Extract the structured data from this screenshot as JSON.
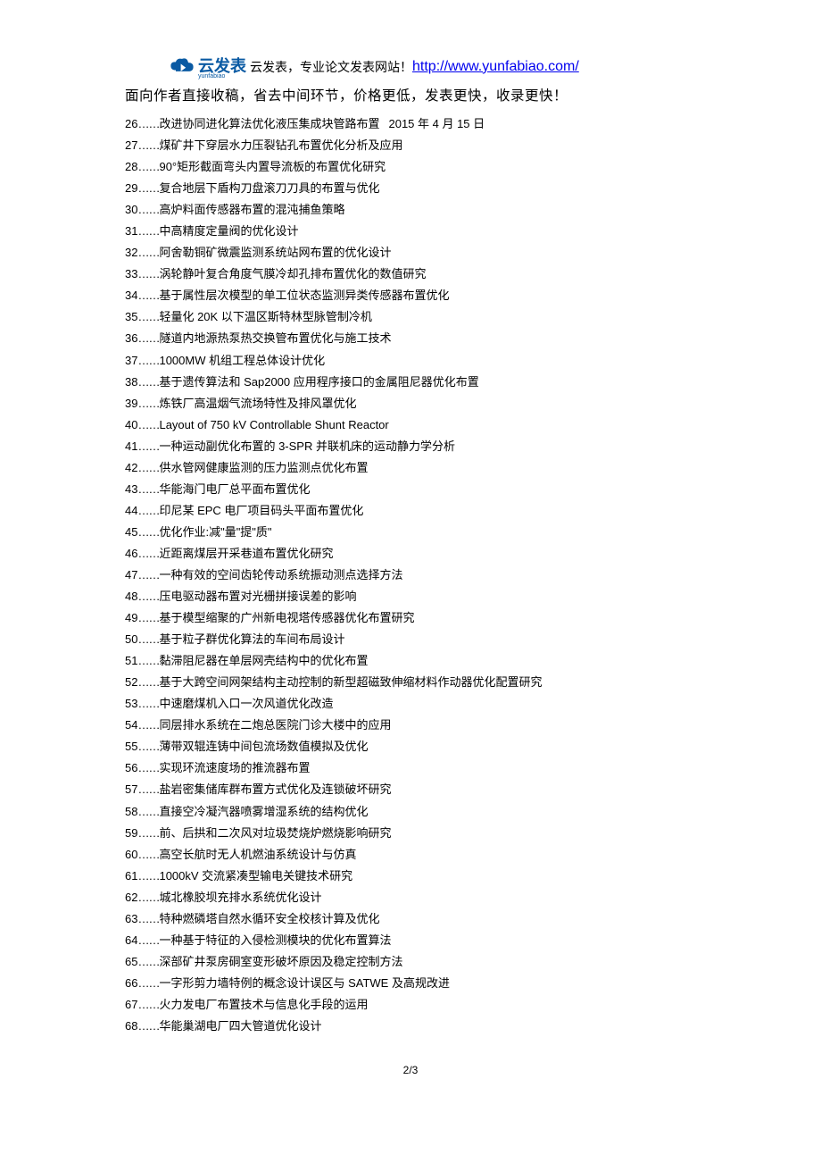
{
  "header": {
    "logo_name": "云发表",
    "logo_pinyin": "yunfabiao",
    "header_text": "云发表，专业论文发表网站！",
    "header_link": "http://www.yunfabiao.com/",
    "subheader": "面向作者直接收稿，省去中间环节，价格更低，发表更快，收录更快！"
  },
  "items": [
    {
      "num": "26",
      "sep": "……",
      "title": "改进协同进化算法优化液压集成块管路布置",
      "extra": "2015 年 4 月 15 日"
    },
    {
      "num": "27",
      "sep": "……",
      "title": "煤矿井下穿层水力压裂钻孔布置优化分析及应用",
      "extra": ""
    },
    {
      "num": "28",
      "sep": "……",
      "title": "90°矩形截面弯头内置导流板的布置优化研究",
      "extra": ""
    },
    {
      "num": "29",
      "sep": "……",
      "title": "复合地层下盾构刀盘滚刀刀具的布置与优化",
      "extra": ""
    },
    {
      "num": "30",
      "sep": "……",
      "title": "高炉料面传感器布置的混沌捕鱼策略",
      "extra": ""
    },
    {
      "num": "31",
      "sep": "……",
      "title": "中高精度定量阀的优化设计",
      "extra": ""
    },
    {
      "num": "32",
      "sep": "……",
      "title": "阿舍勒铜矿微震监测系统站网布置的优化设计",
      "extra": ""
    },
    {
      "num": "33",
      "sep": "……",
      "title": "涡轮静叶复合角度气膜冷却孔排布置优化的数值研究",
      "extra": ""
    },
    {
      "num": "34",
      "sep": "……",
      "title": "基于属性层次模型的单工位状态监测异类传感器布置优化",
      "extra": ""
    },
    {
      "num": "35",
      "sep": "……",
      "title": "轻量化 20K 以下温区斯特林型脉管制冷机",
      "extra": ""
    },
    {
      "num": "36",
      "sep": "……",
      "title": "隧道内地源热泵热交换管布置优化与施工技术",
      "extra": ""
    },
    {
      "num": "37",
      "sep": "……",
      "title": "1000MW 机组工程总体设计优化",
      "extra": ""
    },
    {
      "num": "38",
      "sep": "……",
      "title": "基于遗传算法和 Sap2000 应用程序接口的金属阻尼器优化布置",
      "extra": ""
    },
    {
      "num": "39",
      "sep": "……",
      "title": "炼铁厂高温烟气流场特性及排风罩优化",
      "extra": ""
    },
    {
      "num": "40",
      "sep": "……",
      "title": "Layout of 750 kV Controllable Shunt Reactor",
      "extra": ""
    },
    {
      "num": "41",
      "sep": "……",
      "title": "一种运动副优化布置的 3-SPR 并联机床的运动静力学分析",
      "extra": ""
    },
    {
      "num": "42",
      "sep": "……",
      "title": "供水管网健康监测的压力监测点优化布置",
      "extra": ""
    },
    {
      "num": "43",
      "sep": "……",
      "title": "华能海门电厂总平面布置优化",
      "extra": ""
    },
    {
      "num": "44",
      "sep": "……",
      "title": "印尼某 EPC 电厂项目码头平面布置优化",
      "extra": ""
    },
    {
      "num": "45",
      "sep": "……",
      "title": "优化作业:减\"量\"提\"质\"",
      "extra": ""
    },
    {
      "num": "46",
      "sep": "……",
      "title": "近距离煤层开采巷道布置优化研究",
      "extra": ""
    },
    {
      "num": "47",
      "sep": "……",
      "title": "一种有效的空间齿轮传动系统振动测点选择方法",
      "extra": ""
    },
    {
      "num": "48",
      "sep": "……",
      "title": "压电驱动器布置对光栅拼接误差的影响",
      "extra": ""
    },
    {
      "num": "49",
      "sep": "……",
      "title": "基于模型缩聚的广州新电视塔传感器优化布置研究",
      "extra": ""
    },
    {
      "num": "50",
      "sep": "……",
      "title": "基于粒子群优化算法的车间布局设计",
      "extra": ""
    },
    {
      "num": "51",
      "sep": "……",
      "title": "黏滞阻尼器在单层网壳结构中的优化布置",
      "extra": ""
    },
    {
      "num": "52",
      "sep": "……",
      "title": "基于大跨空间网架结构主动控制的新型超磁致伸缩材料作动器优化配置研究",
      "extra": ""
    },
    {
      "num": "53",
      "sep": "……",
      "title": "中速磨煤机入口一次风道优化改造",
      "extra": ""
    },
    {
      "num": "54",
      "sep": "……",
      "title": "同层排水系统在二炮总医院门诊大楼中的应用",
      "extra": ""
    },
    {
      "num": "55",
      "sep": "……",
      "title": "薄带双辊连铸中间包流场数值模拟及优化",
      "extra": ""
    },
    {
      "num": "56",
      "sep": "……",
      "title": "实现环流速度场的推流器布置",
      "extra": ""
    },
    {
      "num": "57",
      "sep": "……",
      "title": "盐岩密集储库群布置方式优化及连锁破坏研究",
      "extra": ""
    },
    {
      "num": "58",
      "sep": "……",
      "title": "直接空冷凝汽器喷雾增湿系统的结构优化",
      "extra": ""
    },
    {
      "num": "59",
      "sep": "……",
      "title": "前、后拱和二次风对垃圾焚烧炉燃烧影响研究",
      "extra": ""
    },
    {
      "num": "60",
      "sep": "……",
      "title": "高空长航时无人机燃油系统设计与仿真",
      "extra": ""
    },
    {
      "num": "61",
      "sep": "……",
      "title": "1000kV 交流紧凑型输电关键技术研究",
      "extra": ""
    },
    {
      "num": "62",
      "sep": "……",
      "title": "城北橡胶坝充排水系统优化设计",
      "extra": ""
    },
    {
      "num": "63",
      "sep": "……",
      "title": "特种燃磷塔自然水循环安全校核计算及优化",
      "extra": ""
    },
    {
      "num": "64",
      "sep": "……",
      "title": "一种基于特征的入侵检测模块的优化布置算法",
      "extra": ""
    },
    {
      "num": "65",
      "sep": "……",
      "title": "深部矿井泵房硐室变形破坏原因及稳定控制方法",
      "extra": ""
    },
    {
      "num": "66",
      "sep": "……",
      "title": "一字形剪力墙特例的概念设计误区与 SATWE 及高规改进",
      "extra": ""
    },
    {
      "num": "67",
      "sep": "……",
      "title": "火力发电厂布置技术与信息化手段的运用",
      "extra": ""
    },
    {
      "num": "68",
      "sep": "……",
      "title": "华能巢湖电厂四大管道优化设计",
      "extra": ""
    }
  ],
  "page_number": "2/3"
}
